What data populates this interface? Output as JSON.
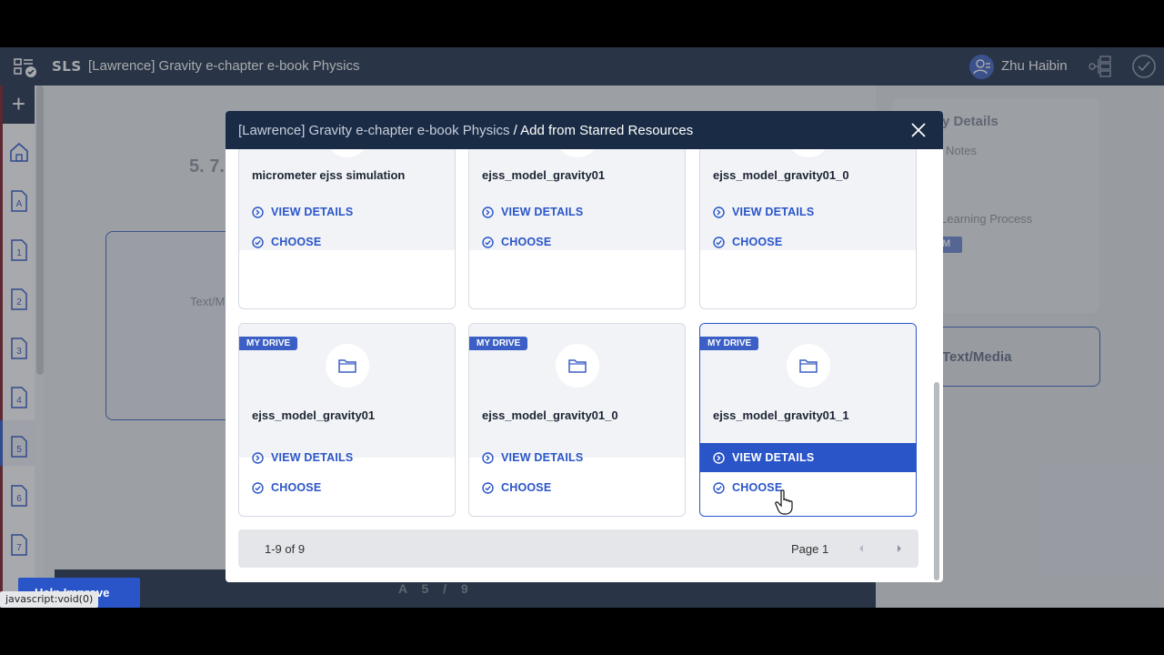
{
  "app": {
    "logo": "SLS",
    "title": "[Lawrence] Gravity e-chapter e-book Physics",
    "user_name": "Zhu Haibin"
  },
  "sidebar": {
    "items": [
      {
        "label": "A",
        "icon": "page-a-icon"
      },
      {
        "label": "1",
        "icon": "page-1-icon"
      },
      {
        "label": "2",
        "icon": "page-2-icon"
      },
      {
        "label": "3",
        "icon": "page-3-icon"
      },
      {
        "label": "4",
        "icon": "page-4-icon"
      },
      {
        "label": "5",
        "icon": "page-5-icon"
      },
      {
        "label": "6",
        "icon": "page-6-icon"
      },
      {
        "label": "7",
        "icon": "page-7-icon"
      }
    ]
  },
  "background": {
    "chapter_heading": "5. 7.",
    "textmedia_small": "Text/M",
    "pager": "A 5 / 9",
    "right_title": "y Details",
    "right_notes": "Notes",
    "right_learning": "Learning Process",
    "right_badge": "M",
    "right_box_label": "Text/Media",
    "status_button": "Help Improve",
    "status_tip": "javascript:void(0)"
  },
  "modal": {
    "crumb_parent": "[Lawrence] Gravity e-chapter e-book Physics",
    "crumb_sep": " / ",
    "crumb_current": "Add from Starred Resources",
    "view_details_label": "VIEW DETAILS",
    "choose_label": "CHOOSE",
    "badge_label": "MY DRIVE",
    "cards": [
      {
        "name": "micrometer ejss simulation"
      },
      {
        "name": "ejss_model_gravity01"
      },
      {
        "name": "ejss_model_gravity01_0"
      },
      {
        "name": "ejss_model_gravity01"
      },
      {
        "name": "ejss_model_gravity01_0"
      },
      {
        "name": "ejss_model_gravity01_1"
      }
    ],
    "footer": {
      "count": "1-9 of 9",
      "page": "Page 1"
    }
  },
  "colors": {
    "navy": "#1a2b45",
    "accent": "#2a55c9"
  }
}
